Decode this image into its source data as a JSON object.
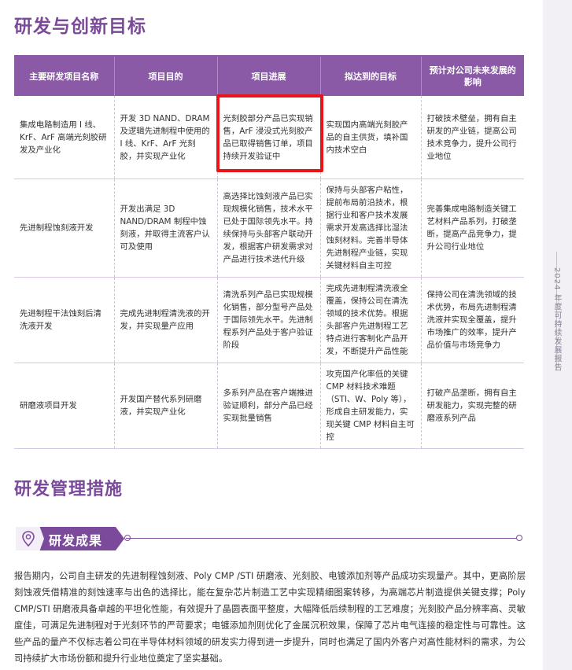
{
  "title": "研发与创新目标",
  "table": {
    "headers": [
      "主要研发项目名称",
      "项目目的",
      "项目进展",
      "拟达到的目标",
      "预计对公司未来发展的影响"
    ],
    "rows": [
      [
        "集成电路制造用 I 线、KrF、ArF 高端光刻胶研发及产业化",
        "开发 3D NAND、DRAM 及逻辑先进制程中使用的 I 线、KrF、ArF 光刻胶，并实现产业化",
        "光刻胶部分产品已实现销售，ArF 浸没式光刻胶产品已取得销售订单，项目持续开发验证中",
        "实现国内高端光刻胶产品的自主供货，填补国内技术空白",
        "打破技术壁垒，拥有自主研发的产业链，提高公司技术竞争力，提升公司行业地位"
      ],
      [
        "先进制程蚀刻液开发",
        "开发出满足 3D NAND/DRAM 制程中蚀刻液，并取得主流客户认可及使用",
        "高选择比蚀刻液产品已实现规模化销售，技术水平已处于国际领先水平。持续保持与头部客户联动开发，根据客户研发需求对产品进行技术迭代升级",
        "保持与头部客户粘性，提前布局前沿技术，根据行业和客户技术发展需求开发高选择比湿法蚀刻材料。完善半导体先进制程产业链，实现关键材料自主可控",
        "完善集成电路制造关键工艺材料产品系列，打破垄断，提高产品竞争力，提升公司行业地位"
      ],
      [
        "先进制程干法蚀刻后清洗液开发",
        "完成先进制程清洗液的开发，并实现量产应用",
        "清洗系列产品已实现规模化销售，部分型号产品处于国际领先水平。先进制程系列产品处于客户验证阶段",
        "完成先进制程清洗液全覆盖，保持公司在清洗领域的技术优势。根据头部客户先进制程工艺特点进行客制化产品开发，不断提升产品性能",
        "保持公司在清洗领域的技术优势，布局先进制程清洗液并实现全覆盖，提升市场推广的效率，提升产品价值与市场竞争力"
      ],
      [
        "研磨液项目开发",
        "开发国产替代系列研磨液，并实现产业化",
        "多系列产品在客户端推进验证顺利，部分产品已经实现批量销售",
        "攻克国产化率低的关键 CMP 材料技术难题（STI、W、Poly 等），形成自主研发能力，实现关键 CMP 材料自主可控",
        "打破产品垄断，拥有自主研发能力，实现完整的研磨液系列产品"
      ]
    ]
  },
  "section2_title": "研发管理措施",
  "subsection_title": "研发成果",
  "paragraph": "报告期内，公司自主研发的先进制程蚀刻液、Poly CMP /STI 研磨液、光刻胶、电镀添加剂等产品成功实现量产。其中，更高阶层刻蚀液凭借精准的刻蚀速率与出色的选择比，能在复杂芯片制造工艺中实现精细图案转移，为高端芯片制造提供关键支撑；Poly CMP/STI 研磨液具备卓越的平坦化性能，有效提升了晶圆表面平整度，大幅降低后续制程的工艺难度；光刻胶产品分辨率高、灵敏度佳，可满足先进制程对于光刻环节的严苛要求；电镀添加剂则优化了金属沉积效果，保障了芯片电气连接的稳定性与可靠性。这些产品的量产不仅标志着公司在半导体材料领域的研发实力得到进一步提升，同时也满足了国内外客户对高性能材料的需求，为公司持续扩大市场份额和提升行业地位奠定了坚实基础。",
  "side_label": "2024 年度可持续发展报告",
  "icons": {
    "banner": "location-pin-icon"
  },
  "colors": {
    "accent": "#7b4a9a",
    "header_bg": "#8a5aa7",
    "highlight": "#e8141b"
  }
}
